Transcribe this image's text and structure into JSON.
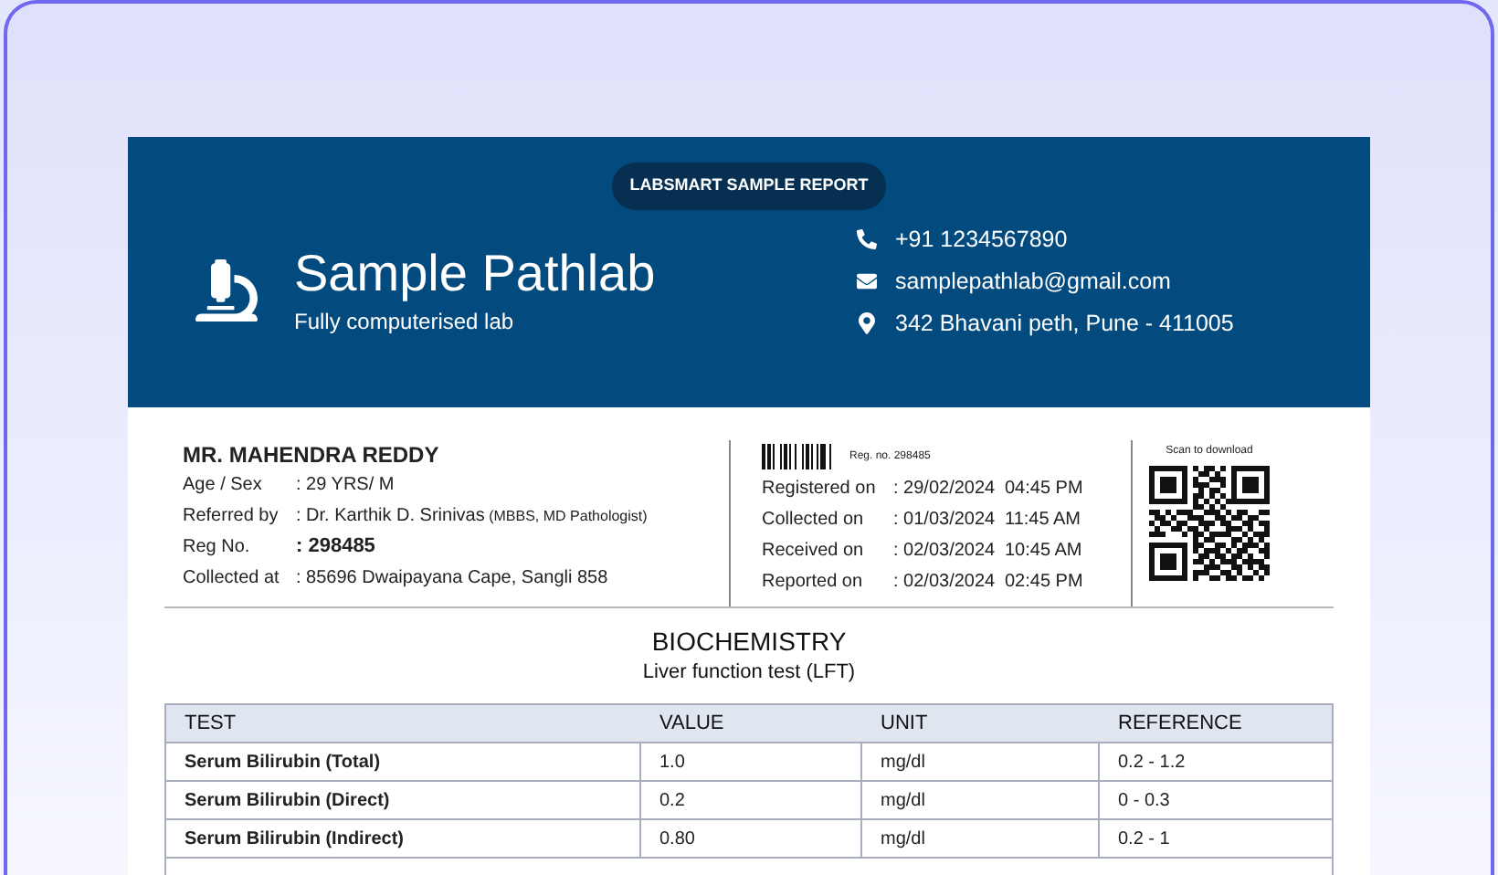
{
  "badge": "LABSMART SAMPLE REPORT",
  "lab": {
    "name": "Sample Pathlab",
    "tagline": "Fully computerised lab"
  },
  "contacts": [
    {
      "kind": "phone",
      "text": "+91 1234567890"
    },
    {
      "kind": "email",
      "text": "samplepathlab@gmail.com"
    },
    {
      "kind": "location",
      "text": "342 Bhavani peth, Pune - 411005"
    }
  ],
  "patient": {
    "name": "MR. MAHENDRA REDDY",
    "fields": [
      {
        "label": "Age / Sex",
        "value": ": 29 YRS/ M",
        "bold": false
      },
      {
        "label": "Referred by",
        "value": ": Dr. Karthik D. Srinivas",
        "note": "(MBBS, MD Pathologist)",
        "bold": false
      },
      {
        "label": "Reg No.",
        "value": ": 298485",
        "bold": true
      },
      {
        "label": "Collected at",
        "value": ": 85696 Dwaipayana Cape, Sangli 858",
        "bold": false
      }
    ]
  },
  "reg_no": "Reg. no. 298485",
  "dates": [
    {
      "label": "Registered on",
      "date": ": 29/02/2024",
      "time": "04:45 PM"
    },
    {
      "label": "Collected on",
      "date": ": 01/03/2024",
      "time": "11:45 AM"
    },
    {
      "label": "Received on",
      "date": ": 02/03/2024",
      "time": "10:45 AM"
    },
    {
      "label": "Reported on",
      "date": ": 02/03/2024",
      "time": "02:45 PM"
    }
  ],
  "qr_caption": "Scan to download",
  "section": {
    "title": "BIOCHEMISTRY",
    "subtitle": "Liver function test (LFT)"
  },
  "table": {
    "columns": [
      "TEST",
      "VALUE",
      "UNIT",
      "REFERENCE"
    ],
    "rows": [
      [
        "Serum Bilirubin (Total)",
        "1.0",
        "mg/dl",
        "0.2 - 1.2"
      ],
      [
        "Serum Bilirubin (Direct)",
        "0.2",
        "mg/dl",
        "0 - 0.3"
      ],
      [
        "Serum Bilirubin (Indirect)",
        "0.80",
        "mg/dl",
        "0.2 - 1"
      ]
    ]
  }
}
